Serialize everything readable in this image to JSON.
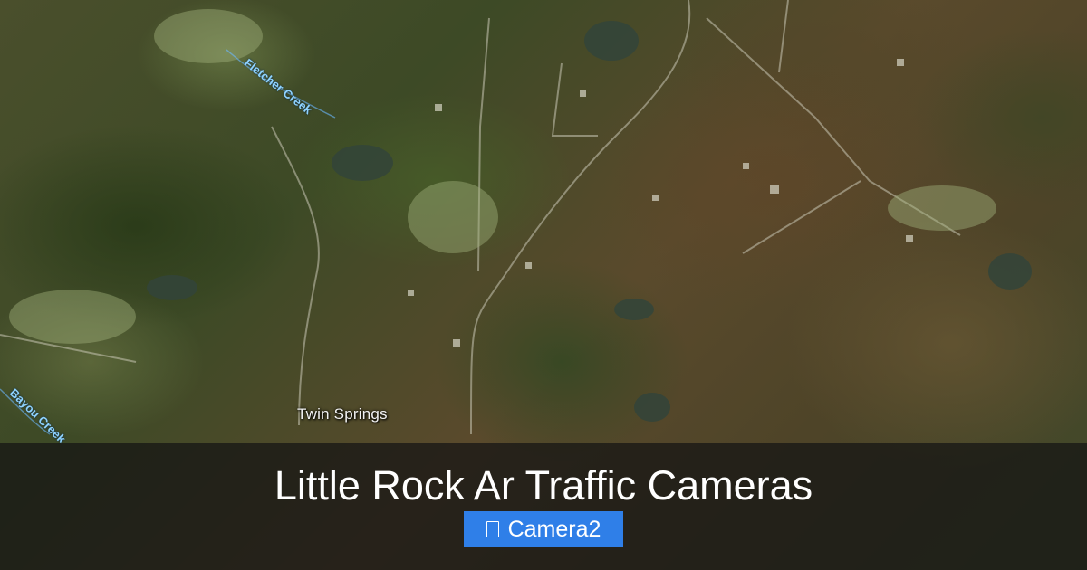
{
  "page": {
    "title": "Little Rock Ar Traffic Cameras"
  },
  "map": {
    "place_label": "Twin Springs",
    "creek_labels": [
      "Fletcher Creek",
      "Bayou Creek"
    ]
  },
  "button": {
    "label": "Camera2",
    "icon": "camera-icon",
    "color": "#2f7fe8"
  }
}
